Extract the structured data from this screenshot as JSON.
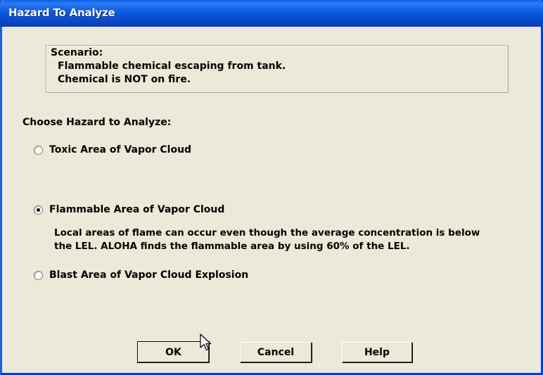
{
  "window": {
    "title": "Hazard To Analyze"
  },
  "scenario": {
    "heading": "Scenario:",
    "lines": [
      "Flammable chemical escaping from tank.",
      "Chemical is NOT on fire."
    ]
  },
  "prompt": "Choose Hazard to Analyze:",
  "options": [
    {
      "label": "Toxic Area of Vapor Cloud",
      "selected": false
    },
    {
      "label": "Flammable Area of Vapor Cloud",
      "selected": true,
      "description": [
        "Local areas of flame can occur even though the average concentration is below",
        "the LEL.  ALOHA finds the flammable area by using 60% of the LEL."
      ]
    },
    {
      "label": "Blast Area of Vapor Cloud Explosion",
      "selected": false
    }
  ],
  "buttons": {
    "ok": "OK",
    "cancel": "Cancel",
    "help": "Help"
  },
  "colors": {
    "titlebar": "#0b5be0",
    "dialog_bg": "#ece9d8",
    "title_text": "#ffffff"
  },
  "icons": {
    "cursor": "arrow-cursor-icon"
  }
}
